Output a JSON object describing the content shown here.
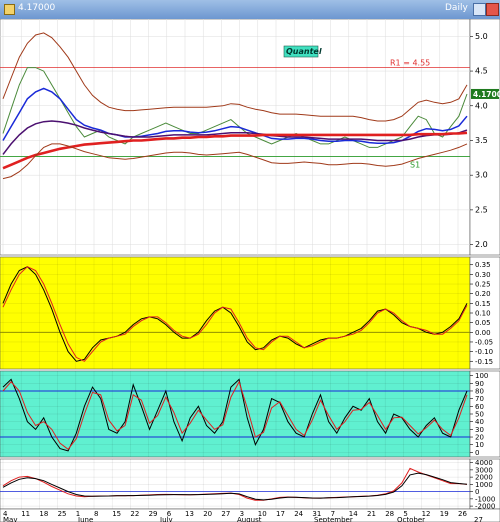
{
  "window": {
    "title": "4.17000",
    "period": "Daily"
  },
  "chart_data": [
    {
      "type": "line",
      "panel": "price",
      "label_box": "Quantel",
      "price_box": "4.1700",
      "levels": [
        {
          "label": "R1 = 4.55",
          "value": 4.55,
          "color": "#e03030"
        },
        {
          "label": "S1",
          "value": 3.27,
          "color": "#2a9a2a"
        }
      ],
      "y_ticks": [
        "5.0",
        "4.5",
        "4.0",
        "3.5",
        "3.0",
        "2.5",
        "2.0"
      ],
      "ylim": [
        1.85,
        5.25
      ],
      "x": [
        0,
        2,
        4,
        6,
        8,
        10,
        12,
        14,
        16,
        18,
        20,
        22,
        24,
        26,
        28,
        30,
        32,
        34,
        36,
        38,
        40,
        42,
        44,
        46,
        48,
        50,
        52,
        54,
        56,
        58,
        60,
        62,
        64,
        66,
        68,
        70,
        72,
        74,
        76,
        78,
        80,
        82,
        84,
        86,
        88,
        90,
        92,
        94,
        96,
        98,
        100,
        102,
        104,
        106,
        108,
        110,
        112,
        114
      ],
      "series": [
        {
          "name": "",
          "color": "#4a8a3a",
          "values": [
            3.6,
            3.95,
            4.3,
            4.55,
            4.55,
            4.5,
            4.3,
            4.1,
            3.9,
            3.7,
            3.55,
            3.6,
            3.65,
            3.55,
            3.5,
            3.45,
            3.55,
            3.6,
            3.65,
            3.7,
            3.75,
            3.7,
            3.65,
            3.6,
            3.6,
            3.65,
            3.7,
            3.75,
            3.8,
            3.7,
            3.6,
            3.55,
            3.5,
            3.45,
            3.5,
            3.55,
            3.6,
            3.55,
            3.5,
            3.45,
            3.45,
            3.5,
            3.55,
            3.5,
            3.45,
            3.4,
            3.4,
            3.45,
            3.5,
            3.55,
            3.7,
            3.85,
            3.8,
            3.6,
            3.55,
            3.7,
            3.85,
            4.17
          ]
        },
        {
          "name": "",
          "color": "#1a2ad8",
          "values": [
            3.5,
            3.7,
            3.9,
            4.1,
            4.2,
            4.25,
            4.2,
            4.1,
            3.95,
            3.8,
            3.72,
            3.68,
            3.65,
            3.6,
            3.58,
            3.55,
            3.55,
            3.56,
            3.58,
            3.6,
            3.63,
            3.64,
            3.64,
            3.62,
            3.61,
            3.62,
            3.64,
            3.67,
            3.7,
            3.69,
            3.65,
            3.61,
            3.57,
            3.53,
            3.52,
            3.52,
            3.53,
            3.53,
            3.52,
            3.5,
            3.49,
            3.49,
            3.5,
            3.5,
            3.49,
            3.47,
            3.46,
            3.46,
            3.47,
            3.5,
            3.56,
            3.63,
            3.67,
            3.66,
            3.64,
            3.66,
            3.71,
            3.85
          ]
        },
        {
          "name": "",
          "color": "#4b1070",
          "values": [
            3.3,
            3.45,
            3.58,
            3.68,
            3.74,
            3.77,
            3.78,
            3.77,
            3.75,
            3.72,
            3.68,
            3.65,
            3.62,
            3.6,
            3.58,
            3.56,
            3.55,
            3.55,
            3.55,
            3.56,
            3.57,
            3.58,
            3.58,
            3.58,
            3.58,
            3.58,
            3.59,
            3.6,
            3.61,
            3.61,
            3.61,
            3.6,
            3.59,
            3.57,
            3.56,
            3.55,
            3.55,
            3.55,
            3.54,
            3.53,
            3.52,
            3.52,
            3.52,
            3.52,
            3.52,
            3.51,
            3.5,
            3.5,
            3.5,
            3.5,
            3.52,
            3.55,
            3.57,
            3.58,
            3.58,
            3.59,
            3.61,
            3.65
          ]
        },
        {
          "name": "",
          "color": "#e02020",
          "values": [
            3.1,
            3.15,
            3.2,
            3.25,
            3.29,
            3.32,
            3.35,
            3.38,
            3.4,
            3.42,
            3.44,
            3.45,
            3.46,
            3.47,
            3.48,
            3.49,
            3.5,
            3.5,
            3.51,
            3.52,
            3.53,
            3.53,
            3.54,
            3.54,
            3.55,
            3.55,
            3.56,
            3.56,
            3.57,
            3.57,
            3.57,
            3.57,
            3.58,
            3.58,
            3.58,
            3.58,
            3.58,
            3.58,
            3.58,
            3.58,
            3.58,
            3.58,
            3.58,
            3.58,
            3.58,
            3.58,
            3.58,
            3.58,
            3.58,
            3.58,
            3.58,
            3.59,
            3.59,
            3.59,
            3.59,
            3.6,
            3.6,
            3.61
          ]
        },
        {
          "name": "",
          "color": "#a03a1a",
          "values": [
            4.1,
            4.4,
            4.7,
            4.9,
            5.02,
            5.05,
            4.98,
            4.85,
            4.7,
            4.5,
            4.3,
            4.15,
            4.05,
            3.98,
            3.95,
            3.93,
            3.93,
            3.94,
            3.95,
            3.96,
            3.97,
            3.98,
            3.98,
            3.98,
            3.98,
            3.98,
            3.99,
            4.0,
            4.03,
            4.02,
            3.98,
            3.95,
            3.93,
            3.9,
            3.88,
            3.88,
            3.88,
            3.87,
            3.86,
            3.85,
            3.85,
            3.85,
            3.85,
            3.85,
            3.83,
            3.8,
            3.78,
            3.78,
            3.8,
            3.85,
            3.95,
            4.05,
            4.08,
            4.05,
            4.03,
            4.05,
            4.1,
            4.3
          ]
        },
        {
          "name": "",
          "color": "#a03a1a",
          "values": [
            2.95,
            2.98,
            3.05,
            3.15,
            3.28,
            3.4,
            3.45,
            3.45,
            3.42,
            3.38,
            3.34,
            3.31,
            3.28,
            3.25,
            3.24,
            3.23,
            3.24,
            3.26,
            3.28,
            3.3,
            3.32,
            3.33,
            3.33,
            3.32,
            3.3,
            3.29,
            3.3,
            3.31,
            3.32,
            3.33,
            3.3,
            3.26,
            3.22,
            3.18,
            3.17,
            3.17,
            3.18,
            3.19,
            3.18,
            3.17,
            3.15,
            3.15,
            3.16,
            3.17,
            3.17,
            3.16,
            3.14,
            3.13,
            3.14,
            3.16,
            3.2,
            3.24,
            3.27,
            3.3,
            3.33,
            3.36,
            3.4,
            3.45
          ]
        }
      ]
    },
    {
      "type": "line",
      "panel": "oscillator",
      "y_ticks": [
        "0.35",
        "0.30",
        "0.25",
        "0.20",
        "0.15",
        "0.10",
        "0.05",
        "0.00",
        "-0.05",
        "-0.10",
        "-0.15"
      ],
      "ylim": [
        -0.19,
        0.39
      ],
      "baseline": 0,
      "x": [
        0,
        2,
        4,
        6,
        8,
        10,
        12,
        14,
        16,
        18,
        20,
        22,
        24,
        26,
        28,
        30,
        32,
        34,
        36,
        38,
        40,
        42,
        44,
        46,
        48,
        50,
        52,
        54,
        56,
        58,
        60,
        62,
        64,
        66,
        68,
        70,
        72,
        74,
        76,
        78,
        80,
        82,
        84,
        86,
        88,
        90,
        92,
        94,
        96,
        98,
        100,
        102,
        104,
        106,
        108,
        110,
        112,
        114
      ],
      "series": [
        {
          "name": "",
          "color": "#000000",
          "values": [
            0.15,
            0.25,
            0.32,
            0.34,
            0.3,
            0.22,
            0.12,
            0.0,
            -0.1,
            -0.15,
            -0.14,
            -0.08,
            -0.04,
            -0.03,
            -0.02,
            0.0,
            0.04,
            0.07,
            0.08,
            0.07,
            0.04,
            0.0,
            -0.03,
            -0.03,
            0.0,
            0.06,
            0.11,
            0.13,
            0.1,
            0.03,
            -0.05,
            -0.09,
            -0.08,
            -0.04,
            -0.02,
            -0.03,
            -0.06,
            -0.08,
            -0.06,
            -0.04,
            -0.03,
            -0.03,
            -0.02,
            0.0,
            0.02,
            0.06,
            0.11,
            0.12,
            0.09,
            0.05,
            0.03,
            0.02,
            0.0,
            -0.01,
            0.0,
            0.03,
            0.07,
            0.15
          ]
        },
        {
          "name": "",
          "color": "#e02020",
          "values": [
            0.13,
            0.22,
            0.3,
            0.34,
            0.32,
            0.25,
            0.15,
            0.04,
            -0.06,
            -0.13,
            -0.15,
            -0.1,
            -0.05,
            -0.03,
            -0.02,
            -0.01,
            0.03,
            0.06,
            0.08,
            0.08,
            0.05,
            0.01,
            -0.02,
            -0.03,
            -0.01,
            0.04,
            0.1,
            0.13,
            0.12,
            0.05,
            -0.03,
            -0.08,
            -0.09,
            -0.05,
            -0.02,
            -0.02,
            -0.05,
            -0.08,
            -0.07,
            -0.05,
            -0.03,
            -0.03,
            -0.02,
            -0.01,
            0.01,
            0.05,
            0.1,
            0.12,
            0.1,
            0.06,
            0.03,
            0.02,
            0.01,
            -0.01,
            -0.01,
            0.02,
            0.06,
            0.14
          ]
        }
      ]
    },
    {
      "type": "line",
      "panel": "stochastic",
      "y_ticks": [
        "100",
        "90",
        "80",
        "70",
        "60",
        "50",
        "40",
        "30",
        "20",
        "10",
        "0"
      ],
      "ylim": [
        -6,
        106
      ],
      "bands": [
        80,
        20
      ],
      "x": [
        0,
        2,
        4,
        6,
        8,
        10,
        12,
        14,
        16,
        18,
        20,
        22,
        24,
        26,
        28,
        30,
        32,
        34,
        36,
        38,
        40,
        42,
        44,
        46,
        48,
        50,
        52,
        54,
        56,
        58,
        60,
        62,
        64,
        66,
        68,
        70,
        72,
        74,
        76,
        78,
        80,
        82,
        84,
        86,
        88,
        90,
        92,
        94,
        96,
        98,
        100,
        102,
        104,
        106,
        108,
        110,
        112,
        114
      ],
      "series": [
        {
          "name": "",
          "color": "#000000",
          "values": [
            85,
            95,
            70,
            40,
            30,
            45,
            20,
            5,
            2,
            25,
            60,
            85,
            70,
            30,
            25,
            40,
            88,
            60,
            30,
            55,
            80,
            40,
            15,
            45,
            60,
            35,
            25,
            40,
            85,
            95,
            45,
            10,
            30,
            70,
            65,
            40,
            25,
            20,
            50,
            75,
            40,
            25,
            45,
            60,
            55,
            70,
            40,
            25,
            50,
            45,
            30,
            20,
            35,
            45,
            25,
            20,
            55,
            80
          ]
        },
        {
          "name": "",
          "color": "#e02020",
          "values": [
            80,
            92,
            80,
            52,
            35,
            40,
            30,
            12,
            4,
            18,
            50,
            78,
            75,
            42,
            28,
            35,
            75,
            68,
            38,
            48,
            72,
            52,
            25,
            38,
            55,
            42,
            30,
            36,
            72,
            92,
            58,
            20,
            26,
            58,
            66,
            48,
            30,
            22,
            42,
            68,
            48,
            30,
            40,
            55,
            56,
            65,
            48,
            30,
            45,
            46,
            35,
            24,
            32,
            42,
            30,
            22,
            45,
            75
          ]
        }
      ]
    },
    {
      "type": "line",
      "panel": "volume-oscillator",
      "y_ticks": [
        "4000",
        "3000",
        "2000",
        "1000",
        "0",
        "-1000",
        "-2000"
      ],
      "ylim": [
        -2400,
        4500
      ],
      "baseline": 0,
      "x": [
        0,
        2,
        4,
        6,
        8,
        10,
        12,
        14,
        16,
        18,
        20,
        22,
        24,
        26,
        28,
        30,
        32,
        34,
        36,
        38,
        40,
        42,
        44,
        46,
        48,
        50,
        52,
        54,
        56,
        58,
        60,
        62,
        64,
        66,
        68,
        70,
        72,
        74,
        76,
        78,
        80,
        82,
        84,
        86,
        88,
        90,
        92,
        94,
        96,
        98,
        100,
        102,
        104,
        106,
        108,
        110,
        112,
        114
      ],
      "series": [
        {
          "name": "",
          "color": "#e02020",
          "values": [
            800,
            1500,
            2000,
            2100,
            1800,
            1300,
            700,
            200,
            -300,
            -600,
            -700,
            -650,
            -600,
            -600,
            -550,
            -550,
            -550,
            -500,
            -450,
            -400,
            -380,
            -400,
            -420,
            -420,
            -400,
            -350,
            -300,
            -250,
            -200,
            -400,
            -900,
            -1200,
            -1200,
            -1000,
            -800,
            -750,
            -800,
            -850,
            -900,
            -900,
            -850,
            -800,
            -750,
            -700,
            -650,
            -600,
            -500,
            -300,
            100,
            1200,
            3200,
            2700,
            2300,
            1900,
            1500,
            1100,
            1100,
            1000
          ]
        },
        {
          "name": "",
          "color": "#000000",
          "values": [
            600,
            1200,
            1700,
            1900,
            1800,
            1500,
            1000,
            500,
            0,
            -400,
            -600,
            -650,
            -620,
            -600,
            -570,
            -560,
            -555,
            -530,
            -490,
            -450,
            -420,
            -410,
            -415,
            -420,
            -410,
            -380,
            -340,
            -290,
            -240,
            -320,
            -700,
            -1050,
            -1150,
            -1050,
            -880,
            -780,
            -790,
            -830,
            -880,
            -890,
            -860,
            -820,
            -770,
            -720,
            -670,
            -620,
            -540,
            -380,
            -60,
            800,
            2300,
            2550,
            2350,
            2000,
            1650,
            1250,
            1120,
            1020
          ]
        }
      ]
    }
  ],
  "x_axis": {
    "day_labels": [
      "4",
      "11",
      "18",
      "25",
      "1",
      "8",
      "15",
      "22",
      "29",
      "6",
      "13",
      "20",
      "27",
      "3",
      "10",
      "17",
      "24",
      "31",
      "7",
      "14",
      "21",
      "28",
      "5",
      "12",
      "19",
      "26"
    ],
    "months": [
      "May",
      "June",
      "July",
      "August",
      "September",
      "October"
    ],
    "corner": "27"
  }
}
